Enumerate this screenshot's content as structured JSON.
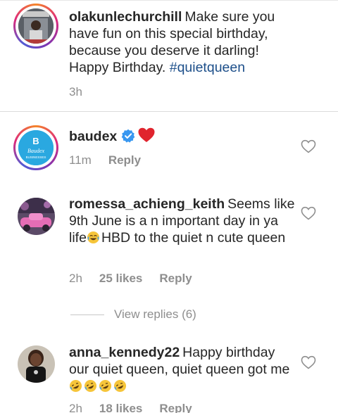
{
  "comments": [
    {
      "username": "olakunlechurchill",
      "text": "Make sure you have fun on this special birthday, because you deserve it darling! Happy Birthday.",
      "hashtag": "#quietqueen",
      "time": "3h"
    },
    {
      "username": "baudex",
      "verified": true,
      "time": "11m",
      "reply_label": "Reply",
      "avatar_text": "Baudex",
      "avatar_subtext": "BUSINESSES"
    },
    {
      "username": "romessa_achieng_keith",
      "text_before_emoji": "Seems like 9th June is a n important day in ya life",
      "text_after_emoji": "HBD to the quiet n cute queen",
      "time": "2h",
      "likes": "25 likes",
      "reply_label": "Reply"
    },
    {
      "username": "anna_kennedy22",
      "text": "Happy birthday our quiet queen, quiet queen got me",
      "time": "2h",
      "likes": "18 likes",
      "reply_label": "Reply"
    }
  ],
  "view_replies_label": "View replies (6)",
  "icons": {
    "like": "heart-outline-icon",
    "verified": "verified-badge-icon",
    "red_heart": "red-heart-emoji",
    "laughing": "rolling-laughing-emoji",
    "crying_laughing": "tears-of-joy-emoji"
  },
  "colors": {
    "hashtag": "#1d4f8a",
    "verified": "#3897f0",
    "red_heart": "#e0242e",
    "meta": "#8e8e8e"
  }
}
